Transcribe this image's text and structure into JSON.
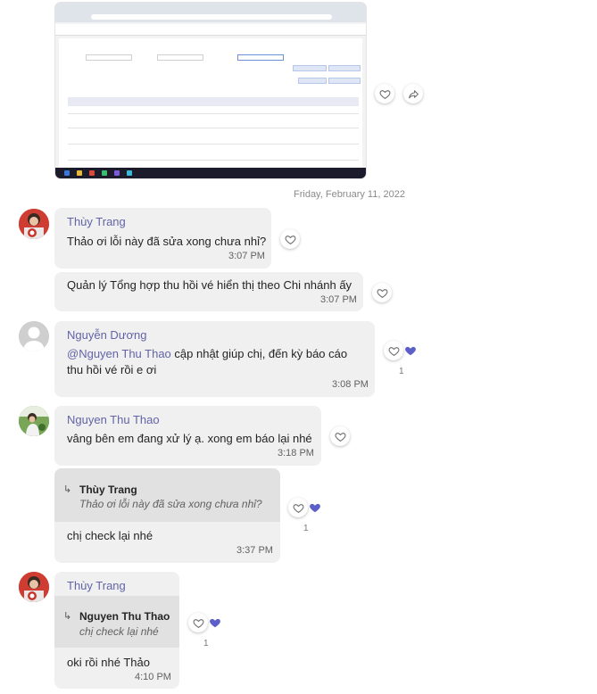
{
  "date_separator": "Friday, February 11, 2022",
  "messages": {
    "m1": {
      "sender": "Thùy Trang",
      "text": "Thảo ơi lỗi này đã sửa xong chưa nhỉ?",
      "time": "3:07 PM"
    },
    "m2": {
      "text": "Quản lý Tổng hợp thu hồi vé hiển thị theo Chi nhánh ấy",
      "time": "3:07 PM"
    },
    "m3": {
      "sender": "Nguyễn Dương",
      "mention": "@Nguyen Thu Thao",
      "text_a": " cập nhật giúp chị, đến kỳ báo cáo",
      "text_b": "thu hồi vé rồi e ơi",
      "time": "3:08 PM",
      "reaction_count": "1"
    },
    "m4": {
      "sender": "Nguyen Thu Thao",
      "text": "vâng bên em đang xử lý ạ. xong em báo lại nhé",
      "time": "3:18 PM"
    },
    "m5": {
      "quote_author": "Thùy Trang",
      "quote_text": "Thảo ơi lỗi này đã sửa xong chưa nhỉ?",
      "text": "chị check lại nhé",
      "time": "3:37 PM",
      "reaction_count": "1"
    },
    "m6": {
      "sender": "Thùy Trang",
      "quote_author": "Nguyen Thu Thao",
      "quote_text": "chị check lại nhé",
      "text": "oki rồi nhé Thảo",
      "time": "4:10 PM",
      "reaction_count": "1"
    }
  },
  "colors": {
    "accent": "#6264a7",
    "bubble": "#f0f0f0",
    "quote": "#e1e1e1",
    "heart_filled": "#5b5fc7"
  },
  "icons": [
    "heart-outline-icon",
    "heart-filled-icon",
    "share-arrow-icon",
    "reply-arrow-icon"
  ]
}
